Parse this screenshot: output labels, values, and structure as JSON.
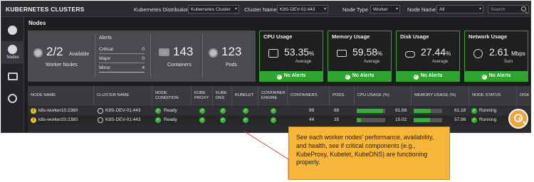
{
  "header": {
    "title": "KUBERNETES CLUSTERS",
    "filters": [
      {
        "label": "Kubernetes Distribution",
        "value": "Kubernetes Cluster"
      },
      {
        "label": "Cluster Name",
        "value": "K8S-DEV-01:443"
      },
      {
        "label": "Node Type",
        "value": "Worker"
      },
      {
        "label": "Node Name",
        "value": "All"
      }
    ],
    "search_placeholder": "Search"
  },
  "sidebar": {
    "items": [
      {
        "icon": "cluster-icon",
        "label": ""
      },
      {
        "icon": "nodes-icon",
        "label": "Nodes"
      },
      {
        "icon": "containers-icon",
        "label": ""
      },
      {
        "icon": "settings-icon",
        "label": ""
      }
    ]
  },
  "section_title": "Nodes",
  "summary": {
    "nodes_value": "2/2",
    "nodes_suffix": "Available",
    "nodes_label": "Worker Nodes",
    "alerts_title": "Alerts",
    "alerts": [
      {
        "label": "Critical",
        "count": "0"
      },
      {
        "label": "Major",
        "count": "0"
      },
      {
        "label": "Minor",
        "count": "4"
      }
    ],
    "containers_value": "143",
    "containers_label": "Containers",
    "pods_value": "123",
    "pods_label": "Pods"
  },
  "metrics": [
    {
      "title": "CPU Usage",
      "value": "53.35",
      "unit": "%",
      "sub": "Average",
      "footer": "No Alerts",
      "icon": "cpu-icon"
    },
    {
      "title": "Memory Usage",
      "value": "59.58",
      "unit": "%",
      "sub": "Average",
      "footer": "No Alerts",
      "icon": "memory-icon"
    },
    {
      "title": "Disk Usage",
      "value": "27.44",
      "unit": "%",
      "sub": "Average",
      "footer": "No Alerts",
      "icon": "disk-icon"
    },
    {
      "title": "Network Usage",
      "value": "2.61",
      "unit": "Mbps",
      "sub": "Sum",
      "footer": "No Alerts",
      "icon": "network-icon"
    }
  ],
  "table": {
    "headers": [
      "NODE NAME",
      "CLUSTER NAME",
      "NODE CONDITION",
      "KUBE PROXY",
      "KUBE DNS",
      "KUBELET",
      "CONTAINER ENGINE",
      "CONTAINERS",
      "PODS",
      "CPU USAGE (%)",
      "MEMORY USAGE (%)",
      "NODE STATUS",
      "DISK"
    ],
    "rows": [
      {
        "node": "k8s-worker10:2380",
        "cluster": "K8S-DEV-01:443",
        "condition": "Ready",
        "containers": "99",
        "pods": "88",
        "cpu": "91.68",
        "cpu_frac": 0.9168,
        "mem": "61.18",
        "mem_frac": 0.6118,
        "status": "Running"
      },
      {
        "node": "k8s-worker20:2380",
        "cluster": "K8S-DEV-01:443",
        "condition": "Ready",
        "containers": "44",
        "pods": "35",
        "cpu": "15.02",
        "cpu_frac": 0.1502,
        "mem": "57.98",
        "mem_frac": 0.5798,
        "status": "Running"
      }
    ]
  },
  "callout": {
    "text": "See each worker nodes' performance, availability, and health, see if critical components (e.g., KubeProxy, Kubelet, KubeDNS) are functioning properly."
  }
}
